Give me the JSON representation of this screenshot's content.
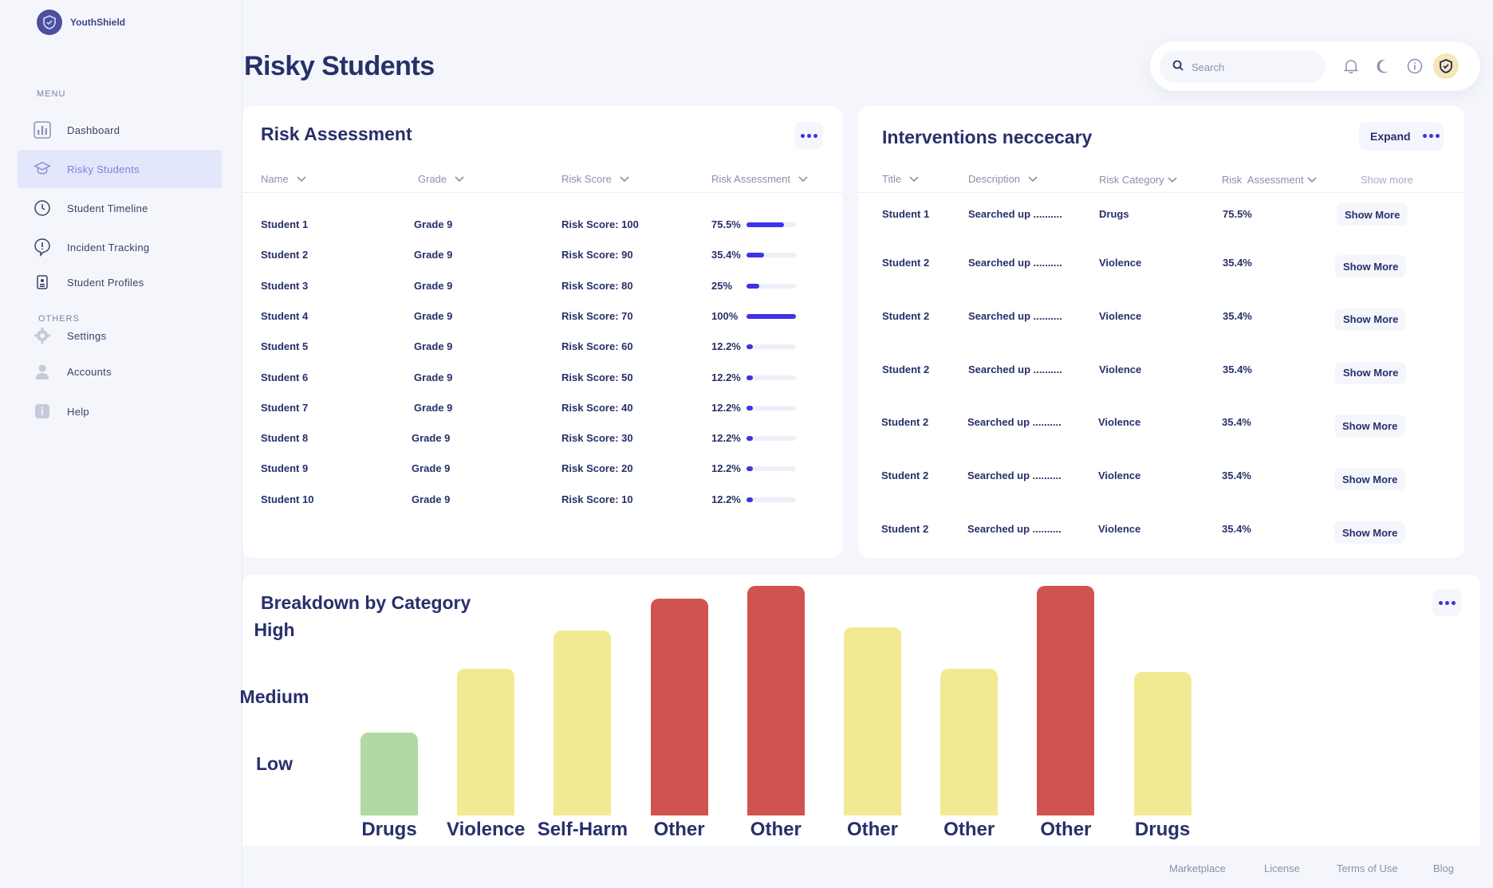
{
  "app": {
    "name": "YouthShield"
  },
  "sidebar": {
    "menu_label": "MENU",
    "others_label": "OTHERS",
    "items": [
      {
        "label": "Dashboard",
        "icon": "bar-chart-icon"
      },
      {
        "label": "Risky Students",
        "icon": "graduation-cap-icon",
        "active": true
      },
      {
        "label": "Student Timeline",
        "icon": "clock-icon"
      },
      {
        "label": "Incident Tracking",
        "icon": "alert-bubble-icon"
      },
      {
        "label": "Student Profiles",
        "icon": "id-badge-icon"
      }
    ],
    "others": [
      {
        "label": "Settings",
        "icon": "gear-icon"
      },
      {
        "label": "Accounts",
        "icon": "user-icon"
      },
      {
        "label": "Help",
        "icon": "info-icon"
      }
    ]
  },
  "header": {
    "page_title": "Risky Students",
    "search_placeholder": "Search"
  },
  "risk_assessment": {
    "title": "Risk Assessment",
    "columns": [
      "Name",
      "Grade",
      "Risk Score",
      "Risk Assessment"
    ],
    "rows": [
      {
        "name": "Student 1",
        "grade": "Grade 9",
        "score": "Risk Score: 100",
        "pct": "75.5%",
        "level": 0.755
      },
      {
        "name": "Student 2",
        "grade": "Grade 9",
        "score": "Risk Score: 90",
        "pct": "35.4%",
        "level": 0.354
      },
      {
        "name": "Student 3",
        "grade": "Grade 9",
        "score": "Risk Score: 80",
        "pct": "25%",
        "level": 0.25
      },
      {
        "name": "Student 4",
        "grade": "Grade 9",
        "score": "Risk Score: 70",
        "pct": "100%",
        "level": 1.0
      },
      {
        "name": "Student 5",
        "grade": "Grade 9",
        "score": "Risk Score: 60",
        "pct": "12.2%",
        "level": 0.122
      },
      {
        "name": "Student 6",
        "grade": "Grade 9",
        "score": "Risk Score: 50",
        "pct": "12.2%",
        "level": 0.122
      },
      {
        "name": "Student 7",
        "grade": "Grade 9",
        "score": "Risk Score: 40",
        "pct": "12.2%",
        "level": 0.122
      },
      {
        "name": "Student 8",
        "grade": "Grade 9",
        "score": "Risk Score: 30",
        "pct": "12.2%",
        "level": 0.122
      },
      {
        "name": "Student 9",
        "grade": "Grade 9",
        "score": "Risk Score: 20",
        "pct": "12.2%",
        "level": 0.122
      },
      {
        "name": "Student 10",
        "grade": "Grade 9",
        "score": "Risk Score: 10",
        "pct": "12.2%",
        "level": 0.122
      }
    ],
    "bar_color": "#3d33e8"
  },
  "interventions": {
    "title": "Interventions neccecary",
    "expand_label": "Expand",
    "columns": [
      "Title",
      "Description",
      "Risk Category",
      "Risk  Assessment",
      "Show more"
    ],
    "rows": [
      {
        "title": "Student 1",
        "description": "Searched up ..........",
        "category": "Drugs",
        "assessment": "75.5%",
        "action": "Show More"
      },
      {
        "title": "Student 2",
        "description": "Searched up ..........",
        "category": "Violence",
        "assessment": "35.4%",
        "action": "Show More"
      },
      {
        "title": "Student 2",
        "description": "Searched up ..........",
        "category": "Violence",
        "assessment": "35.4%",
        "action": "Show More"
      },
      {
        "title": "Student 2",
        "description": "Searched up ..........",
        "category": "Violence",
        "assessment": "35.4%",
        "action": "Show More"
      },
      {
        "title": "Student 2",
        "description": "Searched up ..........",
        "category": "Violence",
        "assessment": "35.4%",
        "action": "Show More"
      },
      {
        "title": "Student 2",
        "description": "Searched up ..........",
        "category": "Violence",
        "assessment": "35.4%",
        "action": "Show More"
      },
      {
        "title": "Student 2",
        "description": "Searched up ..........",
        "category": "Violence",
        "assessment": "35.4%",
        "action": "Show More"
      }
    ]
  },
  "chart_data": {
    "type": "bar",
    "title": "Breakdown by Category",
    "categories": [
      "Drugs",
      "Violence",
      "Self-Harm",
      "Other",
      "Other",
      "Other",
      "Other",
      "Other",
      "Drugs"
    ],
    "values": [
      1.3,
      2.3,
      2.9,
      3.4,
      3.6,
      2.95,
      2.3,
      3.6,
      2.25
    ],
    "colors": [
      "#b1d9a1",
      "#f1ea93",
      "#f1ea93",
      "#d1534f",
      "#d1534f",
      "#f1ea93",
      "#f1ea93",
      "#d1534f",
      "#f1ea93"
    ],
    "y_tick_labels": [
      "Low",
      "Medium",
      "High"
    ],
    "y_tick_values": [
      1,
      2,
      3
    ],
    "ylim": [
      0,
      3.7
    ],
    "xlabel": "",
    "ylabel": "",
    "grid": false,
    "legend": "none"
  },
  "footer": {
    "links": [
      "Marketplace",
      "License",
      "Terms of Use",
      "Blog"
    ]
  },
  "colors": {
    "accent": "#3d33e8",
    "title": "#27306a",
    "active_nav_bg": "#e3e7fb"
  }
}
